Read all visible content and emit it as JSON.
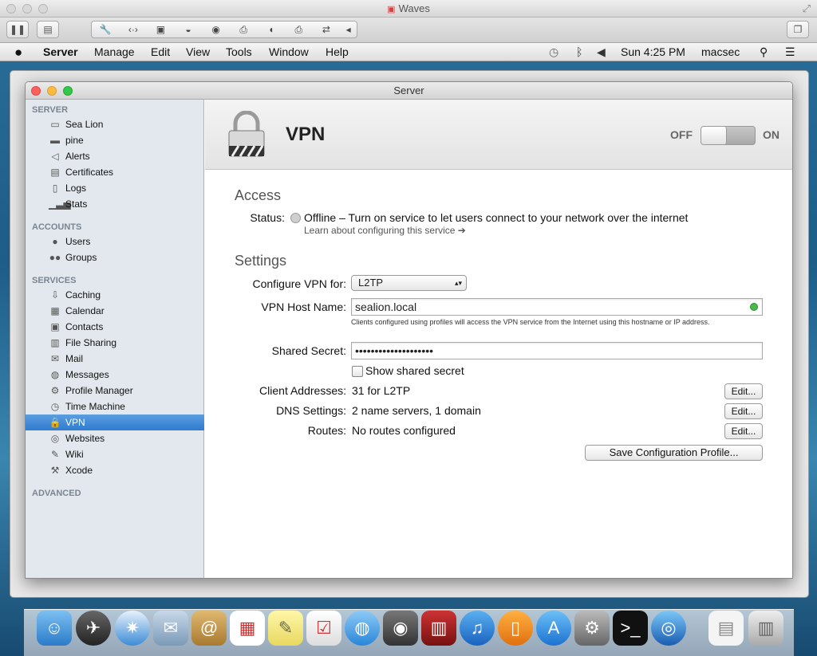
{
  "vm_window": {
    "title": "Waves"
  },
  "menubar": {
    "app": "Server",
    "items": [
      "Manage",
      "Edit",
      "View",
      "Tools",
      "Window",
      "Help"
    ],
    "clock": "Sun 4:25 PM",
    "user": "macsec"
  },
  "server_window": {
    "title": "Server"
  },
  "sidebar": {
    "sections": {
      "server": "SERVER",
      "accounts": "ACCOUNTS",
      "services": "SERVICES",
      "advanced": "ADVANCED"
    },
    "server_items": [
      {
        "label": "Sea Lion",
        "icon": "computer-icon"
      },
      {
        "label": "pine",
        "icon": "disk-icon"
      },
      {
        "label": "Alerts",
        "icon": "megaphone-icon"
      },
      {
        "label": "Certificates",
        "icon": "certificate-icon"
      },
      {
        "label": "Logs",
        "icon": "log-icon"
      },
      {
        "label": "Stats",
        "icon": "stats-icon"
      }
    ],
    "account_items": [
      {
        "label": "Users",
        "icon": "user-icon"
      },
      {
        "label": "Groups",
        "icon": "group-icon"
      }
    ],
    "service_items": [
      {
        "label": "Caching",
        "icon": "caching-icon"
      },
      {
        "label": "Calendar",
        "icon": "calendar-icon"
      },
      {
        "label": "Contacts",
        "icon": "contacts-icon"
      },
      {
        "label": "File Sharing",
        "icon": "file-sharing-icon"
      },
      {
        "label": "Mail",
        "icon": "mail-icon"
      },
      {
        "label": "Messages",
        "icon": "messages-icon"
      },
      {
        "label": "Profile Manager",
        "icon": "profile-manager-icon"
      },
      {
        "label": "Time Machine",
        "icon": "time-machine-icon"
      },
      {
        "label": "VPN",
        "icon": "lock-icon",
        "selected": true
      },
      {
        "label": "Websites",
        "icon": "globe-icon"
      },
      {
        "label": "Wiki",
        "icon": "wiki-icon"
      },
      {
        "label": "Xcode",
        "icon": "hammer-icon"
      }
    ]
  },
  "header": {
    "title": "VPN",
    "off_label": "OFF",
    "on_label": "ON",
    "service_on": false
  },
  "access": {
    "heading": "Access",
    "status_label": "Status:",
    "status_text": "Offline – Turn on service to let users connect to your network over the internet",
    "learn_link": "Learn about configuring this service"
  },
  "settings": {
    "heading": "Settings",
    "configure_label": "Configure VPN for:",
    "configure_value": "L2TP",
    "host_label": "VPN Host Name:",
    "host_value": "sealion.local",
    "host_hint": "Clients configured using profiles will access the VPN service from the Internet using this hostname or IP address.",
    "secret_label": "Shared Secret:",
    "secret_value": "••••••••••••••••••••",
    "show_secret_label": "Show shared secret",
    "client_label": "Client Addresses:",
    "client_value": "31 for L2TP",
    "dns_label": "DNS Settings:",
    "dns_value": "2 name servers, 1 domain",
    "routes_label": "Routes:",
    "routes_value": "No routes configured",
    "edit_label": "Edit...",
    "save_profile_label": "Save Configuration Profile..."
  },
  "colors": {
    "selection": "#2f7bd1",
    "status_green": "#49b94a"
  }
}
